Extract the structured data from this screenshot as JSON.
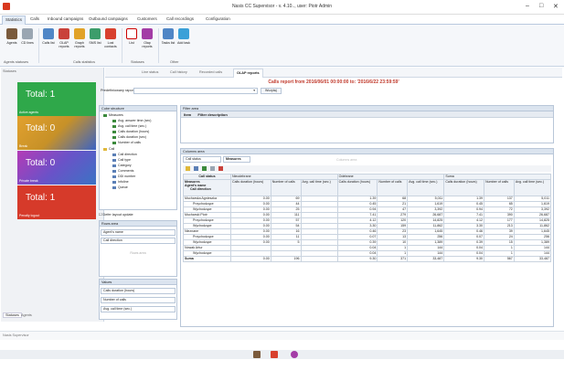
{
  "window": {
    "title": "Nasis CC Supervisor - v. 4.10.., user: Piotr Admin",
    "min": "–",
    "max": "□",
    "close": "✕"
  },
  "menu": [
    "Statistics",
    "Calls",
    "Inbound campaigns",
    "Outbound campaigns",
    "Customers",
    "Call recordings",
    "Configuration"
  ],
  "ribbon": {
    "items": [
      "Agents",
      "CD\nlines",
      "Calls\nlist",
      "OLAP\nreports",
      "Graph\nreports",
      "SMS\nlist",
      "Lost\ncontacts",
      "List",
      "Olap\nreports",
      "Tasks\nlist",
      "Add\ntask"
    ],
    "groups": [
      "Agents statuses",
      "Calls statistics",
      "Statuses",
      "Other"
    ]
  },
  "left": {
    "header": "Statuses",
    "tiles": [
      {
        "value": "Total: 1",
        "label": "Active agents"
      },
      {
        "value": "Total: 0",
        "label": "Break"
      },
      {
        "value": "Total: 0",
        "label": "Private break"
      },
      {
        "value": "Total: 1",
        "label": "Penalty logout"
      }
    ],
    "bottom_tabs": [
      "Statuses",
      "Agents"
    ]
  },
  "tabs": [
    "Line status",
    "Call history",
    "Recorded calls",
    "OLAP reports"
  ],
  "report": {
    "title": "Calls report from 2016/06/01 00:00:00 to: '2016/6/22 23:59:59'",
    "predefined_label": "Predefiniowany raport:",
    "button": "Wczytaj"
  },
  "cube": {
    "header": "Cube structure",
    "items": [
      "Measures",
      "Avg. answer time (sec)",
      "Avg. call time (sec.)",
      "Calls duration (hours)",
      "Calls duration (sec)",
      "Number of calls",
      "Call",
      "Call direction",
      "Call type",
      "Category",
      "Comments",
      "DDI number",
      "Infoline",
      "Queue"
    ],
    "defer": "Defer layout update"
  },
  "rows_area": {
    "header": "Rows area",
    "items": [
      "Agent's name",
      "Call direction"
    ],
    "placeholder": "Rows area"
  },
  "values_area": {
    "header": "Values",
    "items": [
      "Calls duration (hours)",
      "Number of calls",
      "Avg. call time (sec.)"
    ]
  },
  "filter": {
    "header": "Filter area",
    "cols": [
      "Item",
      "Filter description"
    ]
  },
  "columns_area": {
    "header": "Columns area",
    "chips": [
      "Call status",
      "Measures"
    ],
    "placeholder": "Columns area"
  },
  "grid": {
    "col_groups": [
      "Call status",
      "Nieodebrane",
      "Odebrane",
      "Suma"
    ],
    "measure_headers": [
      "Calls duration (hours)",
      "Number of calls",
      "Avg. call time (sec.)"
    ],
    "row_headers": [
      "Measures",
      "Agent's name",
      "Call direction"
    ],
    "rows": [
      {
        "name": "Mucharska Agnieszka",
        "dir": "",
        "v": [
          "0.00",
          "69",
          "",
          "1.39",
          "68",
          "5,011",
          "1.39",
          "137",
          "5,011"
        ]
      },
      {
        "name": "",
        "dir": "Przychodzące",
        "v": [
          "0.00",
          "44",
          "",
          "0.45",
          "21",
          "1,619",
          "0.45",
          "65",
          "1,619"
        ]
      },
      {
        "name": "",
        "dir": "Wychodzące",
        "v": [
          "0.00",
          "25",
          "",
          "0.94",
          "47",
          "3,392",
          "0.94",
          "72",
          "3,392"
        ]
      },
      {
        "name": "Mucharski Piotr",
        "dir": "",
        "v": [
          "0.00",
          "111",
          "",
          "7.41",
          "279",
          "26,687",
          "7.41",
          "390",
          "26,687"
        ]
      },
      {
        "name": "",
        "dir": "Przychodzące",
        "v": [
          "0.00",
          "57",
          "",
          "4.12",
          "120",
          "14,825",
          "4.12",
          "177",
          "14,825"
        ]
      },
      {
        "name": "",
        "dir": "Wychodzące",
        "v": [
          "0.00",
          "54",
          "",
          "3.30",
          "159",
          "11,862",
          "3.30",
          "213",
          "11,862"
        ]
      },
      {
        "name": "Nieznane",
        "dir": "",
        "v": [
          "0.00",
          "16",
          "",
          "0.46",
          "23",
          "1,645",
          "0.46",
          "39",
          "1,645"
        ]
      },
      {
        "name": "",
        "dir": "Przychodzące",
        "v": [
          "0.00",
          "11",
          "",
          "0.07",
          "13",
          "256",
          "0.07",
          "24",
          "256"
        ]
      },
      {
        "name": "",
        "dir": "Wychodzące",
        "v": [
          "0.00",
          "5",
          "",
          "0.39",
          "10",
          "1,389",
          "0.39",
          "15",
          "1,389"
        ]
      },
      {
        "name": "Nowak Artur",
        "dir": "",
        "v": [
          "",
          "",
          "",
          "0.04",
          "1",
          "144",
          "0.04",
          "1",
          "144"
        ]
      },
      {
        "name": "",
        "dir": "Wychodzące",
        "v": [
          "",
          "",
          "",
          "0.04",
          "1",
          "144",
          "0.04",
          "1",
          "144"
        ]
      },
      {
        "name": "Suma",
        "dir": "",
        "v": [
          "0.00",
          "196",
          "",
          "9.30",
          "371",
          "33,487",
          "9.30",
          "567",
          "33,487"
        ]
      }
    ]
  },
  "status": {
    "text": "Nasis Supervisor"
  }
}
